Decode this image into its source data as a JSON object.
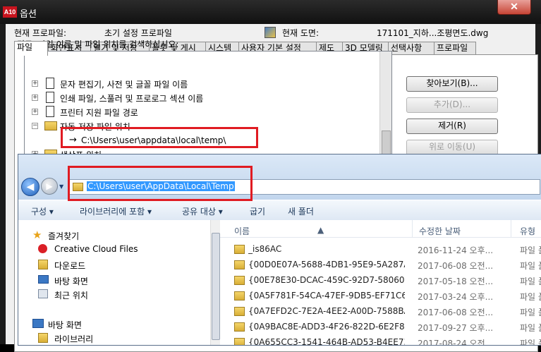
{
  "background_window": {
    "logo_text": "A10",
    "title": "옵션",
    "close_glyph": "✕",
    "current_profile_label": "현재 프로파일:",
    "current_profile_value": "초기 설정 프로파일",
    "current_drawing_label": "현재 도면:",
    "current_drawing_value": "171101_지하...조평면도.dwg",
    "tabs": [
      "파일",
      "화면표시",
      "열기 및 저장",
      "플롯 및 게시",
      "시스템",
      "사용자 기본 설정",
      "제도",
      "3D 모델링",
      "선택사항",
      "프로파일"
    ],
    "search_label": "경로, 파일 이름 및 파일 위치를 검색하십시오:",
    "tree_items": [
      {
        "label": "문자 편집기, 사전 및 글꼴 파일 이름",
        "expander": "+"
      },
      {
        "label": "인쇄 파일, 스풀러 및 프로로그 섹션 이름",
        "expander": "+"
      },
      {
        "label": "프린터 지원 파일 경로",
        "expander": "+"
      },
      {
        "label": "자동 저장 파일 위치",
        "expander": "−"
      }
    ],
    "autosave_path": "C:\\Users\\user\\appdata\\local\\temp\\",
    "tree_item_partial": "색상표 위치",
    "buttons": {
      "browse": "찾아보기(B)...",
      "add": "추가(D)...",
      "remove": "제거(R)",
      "move_up": "위로 이동(U)"
    }
  },
  "explorer": {
    "nav_back_glyph": "◀",
    "nav_forward_glyph": "▶",
    "nav_dropdown_glyph": "▼",
    "address": "C:\\Users\\user\\AppData\\Local\\Temp",
    "toolbar": {
      "organize": "구성 ▾",
      "include_in_library": "라이브러리에 포함 ▾",
      "share_with": "공유 대상 ▾",
      "burn": "굽기",
      "new_folder": "새 폴더"
    },
    "nav_items": [
      {
        "label": "즐겨찾기",
        "icon": "star-icon"
      },
      {
        "label": "Creative Cloud Files",
        "icon": "creative-cloud-icon"
      },
      {
        "label": "다운로드",
        "icon": "downloads-icon"
      },
      {
        "label": "바탕 화면",
        "icon": "desktop-icon"
      },
      {
        "label": "최근 위치",
        "icon": "recent-places-icon"
      },
      {
        "label": "바탕 화면",
        "icon": "desktop-icon"
      },
      {
        "label": "라이브러리",
        "icon": "library-icon"
      }
    ],
    "columns": {
      "name": "이름",
      "modified": "수정한 날짜",
      "type": "유형"
    },
    "files": [
      {
        "name": "_is86AC",
        "date": "2016-11-24 오후...",
        "type": "파일 폴더"
      },
      {
        "name": "{00D0E07A-5688-4DB1-95E9-5A287A...",
        "date": "2017-06-08 오전...",
        "type": "파일 폴더"
      },
      {
        "name": "{00E78E30-DCAC-459C-92D7-58060D...",
        "date": "2017-05-18 오전...",
        "type": "파일 폴더"
      },
      {
        "name": "{0A5F781F-54CA-47EF-9DB5-EF71C60...",
        "date": "2017-03-24 오후...",
        "type": "파일 폴더"
      },
      {
        "name": "{0A7EFD2C-7E2A-4EE2-A00D-7588BA4...",
        "date": "2017-06-08 오전...",
        "type": "파일 폴더"
      },
      {
        "name": "{0A9BAC8E-ADD3-4F26-822D-6E2F8E...",
        "date": "2017-09-27 오후...",
        "type": "파일 폴더"
      },
      {
        "name": "{0A655CC3-1541-464B-AD53-B4EE731...",
        "date": "2017-08-24 오전...",
        "type": "파일 폴더"
      }
    ]
  },
  "colors": {
    "highlight_box": "#e01b22",
    "address_selection": "#3399ff",
    "close_button": "#c74536"
  }
}
